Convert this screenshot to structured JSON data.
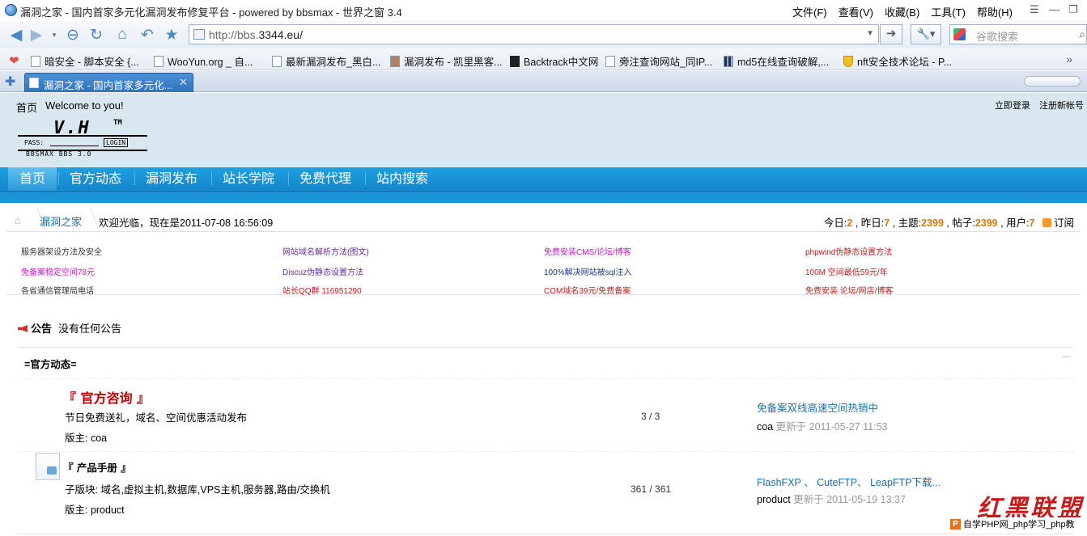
{
  "browser": {
    "title": "漏洞之家 - 国内首家多元化漏洞发布修复平台 - powered by bbsmax - 世界之窗 3.4",
    "menu": [
      "文件(F)",
      "查看(V)",
      "收藏(B)",
      "工具(T)",
      "帮助(H)"
    ],
    "url_prefix": "http://bbs.",
    "url_host": "3344.eu/",
    "search_placeholder": "谷歌搜索",
    "bookmarks": [
      "暗安全 - 脚本安全 {...",
      "WooYun.org _ 自...",
      "最新漏洞发布_黑白...",
      "漏洞发布 - 凯里黑客...",
      "Backtrack中文网",
      "旁注查询网站_同IP...",
      "md5在线查询破解,...",
      "nft安全技术论坛 - P..."
    ],
    "tab_label": "漏洞之家 - 国内首家多元化..."
  },
  "header": {
    "home": "首页",
    "welcome": "Welcome to you!",
    "login": "立即登录",
    "register": "注册新帐号",
    "logo_main": "V.H",
    "logo_tm": "TM",
    "logo_pass": "PASS:",
    "logo_login": "LOGIN",
    "logo_tag": "BBSMAX BBS 3.0"
  },
  "nav": [
    "首页",
    "官方动态",
    "漏洞发布",
    "站长学院",
    "免费代理",
    "站内搜索"
  ],
  "crumb": {
    "forum": "漏洞之家",
    "now_text": "欢迎光临，现在是2011-07-08 16:56:09"
  },
  "stats": {
    "today_label": "今日:",
    "today": "2",
    "yesterday_label": "昨日:",
    "yesterday": "7",
    "topics_label": "主题:",
    "topics": "2399",
    "posts_label": "帖子:",
    "posts": "2399",
    "users_label": "用户:",
    "users": "7",
    "rss": "订阅"
  },
  "ads": [
    {
      "text": "服务器架设方法及安全",
      "color": "#333333"
    },
    {
      "text": "网站域名解析方法(图文)",
      "color": "#6a2aa8"
    },
    {
      "text": "免费安装CMS/论坛/博客",
      "color": "#c020c0"
    },
    {
      "text": "phpwind伪静态设置方法",
      "color": "#c02020"
    },
    {
      "text": "免备案稳定空间78元",
      "color": "#c020c0"
    },
    {
      "text": "Discuz伪静态设置方法",
      "color": "#6a2aa8"
    },
    {
      "text": "100%解决网站被sql注入",
      "color": "#1a3a8a"
    },
    {
      "text": "100M 空间最低59元/年",
      "color": "#c02020"
    },
    {
      "text": "各省通信管理局电话",
      "color": "#333333"
    },
    {
      "text": "站长QQ群 116951290",
      "color": "#c02020"
    },
    {
      "text": "COM域名39元/免费备案",
      "color": "#c02020"
    },
    {
      "text": "免费安装 论坛/网店/博客",
      "color": "#c02020"
    }
  ],
  "notice": {
    "label": "公告",
    "text": "没有任何公告"
  },
  "section_title": "=官方动态=",
  "forums": [
    {
      "name": "『 官方咨询 』",
      "desc": "节日免费送礼，域名、空间优惠活动发布",
      "mod": "版主: coa",
      "count": "3 / 3",
      "last_title": "免备案双线高速空间热销中",
      "last_user": "coa",
      "updated": "更新于",
      "last_time": "2011-05-27 11:53"
    },
    {
      "name": "『 产品手册 』",
      "desc": "子版块: 域名,虚拟主机,数据库,VPS主机,服务器,路由/交换机",
      "mod": "版主: product",
      "count": "361 / 361",
      "last_title": "FlashFXP 、 CuteFTP、 LeapFTP下载...",
      "last_user": "product",
      "updated": "更新于",
      "last_time": "2011-05-19 13:37"
    }
  ],
  "watermark": "红黑联盟",
  "footer_brand": "自学PHP网_php学习_php教"
}
